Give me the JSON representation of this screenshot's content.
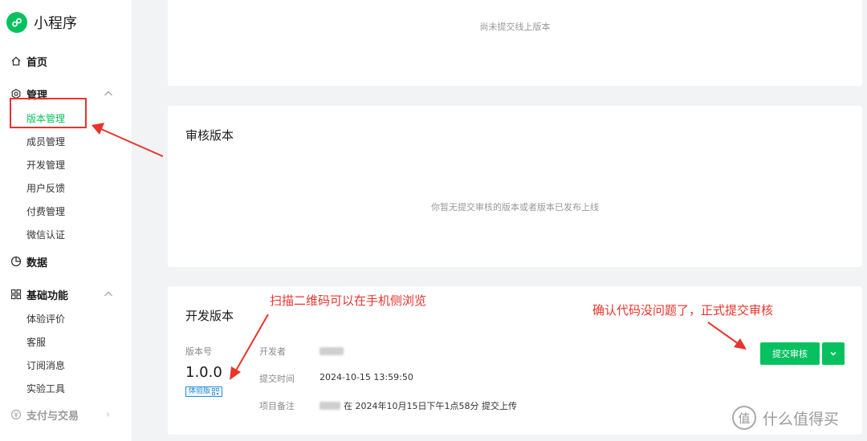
{
  "app": {
    "title": "小程序"
  },
  "sidebar": {
    "home": "首页",
    "manage": {
      "label": "管理",
      "items": [
        "版本管理",
        "成员管理",
        "开发管理",
        "用户反馈",
        "付费管理",
        "微信认证"
      ]
    },
    "data": "数据",
    "basic": {
      "label": "基础功能",
      "items": [
        "体验评价",
        "客服",
        "订阅消息",
        "实验工具"
      ]
    },
    "pay": "支付与交易"
  },
  "online": {
    "empty_text": "尚未提交线上版本"
  },
  "review": {
    "title": "审核版本",
    "empty_text": "你暂无提交审核的版本或者版本已发布上线"
  },
  "dev": {
    "title": "开发版本",
    "version_label": "版本号",
    "version": "1.0.0",
    "badge": "体验版",
    "developer_label": "开发者",
    "submit_time_label": "提交时间",
    "submit_time": "2024-10-15 13:59:50",
    "note_label": "项目备注",
    "note_text": "在 2024年10月15日下午1点58分 提交上传",
    "submit_button": "提交审核"
  },
  "annotations": {
    "scan": "扫描二维码可以在手机侧浏览",
    "confirm": "确认代码没问题了，正式提交审核"
  },
  "watermark": {
    "glyph": "值",
    "text": "什么值得买"
  },
  "colors": {
    "accent": "#07c160",
    "annotation": "#e8342c",
    "badge": "#2b8fd6"
  }
}
